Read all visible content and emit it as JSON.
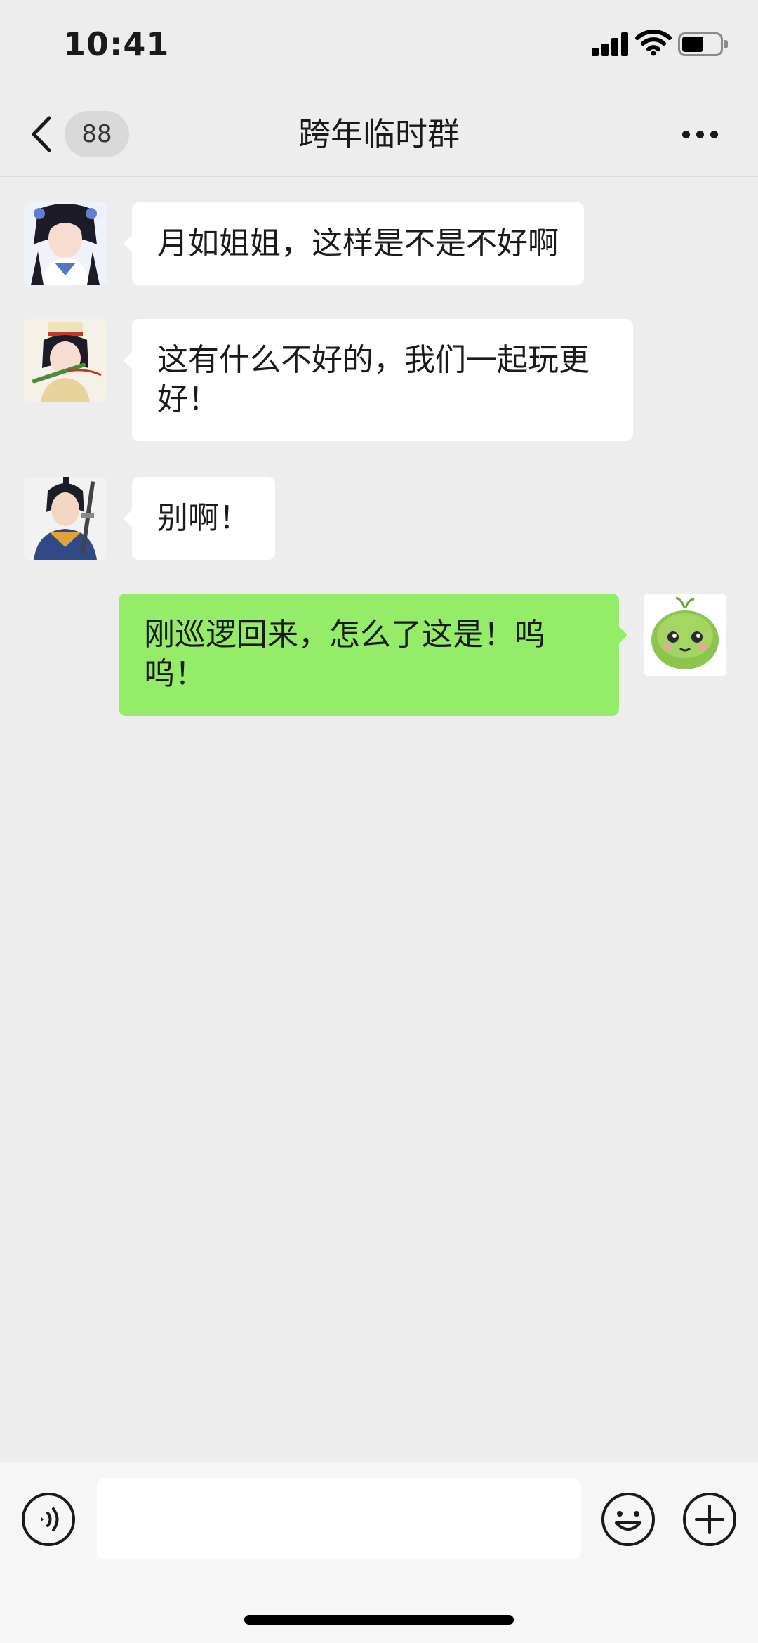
{
  "status_bar": {
    "time": "10:41"
  },
  "nav": {
    "unread_count": "88",
    "title": "跨年临时群"
  },
  "messages": [
    {
      "side": "in",
      "avatar": "girl-hanfu-avatar",
      "text": "月如姐姐，这样是不是不好啊"
    },
    {
      "side": "in",
      "avatar": "girl-flute-avatar",
      "text": "这有什么不好的，我们一起玩更好！"
    },
    {
      "side": "in",
      "avatar": "swordsman-avatar",
      "text": "别啊！"
    },
    {
      "side": "out",
      "avatar": "green-bush-avatar",
      "text": "刚巡逻回来，怎么了这是！呜呜！"
    }
  ],
  "input_bar": {
    "input_value": "",
    "placeholder": ""
  },
  "colors": {
    "background": "#ededed",
    "incoming_bubble": "#ffffff",
    "outgoing_bubble": "#95ec69"
  }
}
